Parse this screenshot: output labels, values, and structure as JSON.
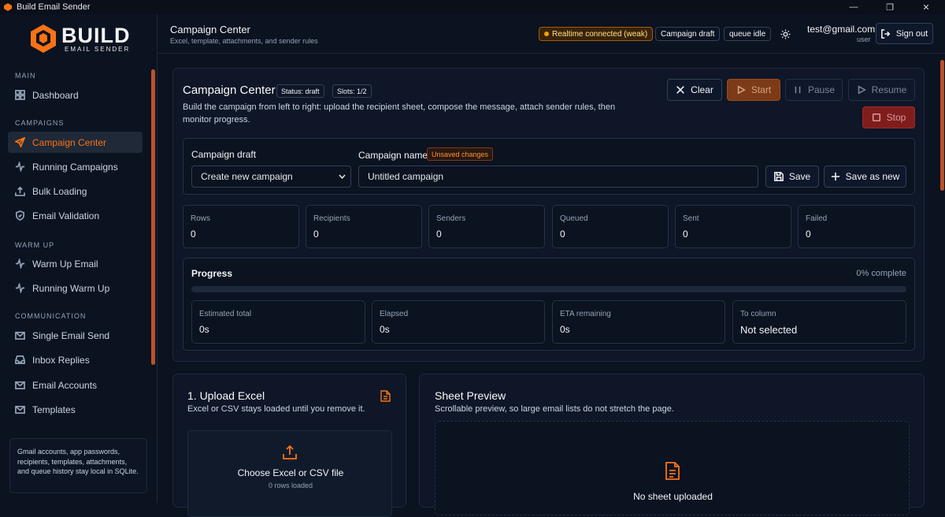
{
  "window": {
    "title": "Build Email Sender"
  },
  "brand": {
    "name": "BUILD",
    "tagline": "EMAIL SENDER",
    "accent": "#f97316"
  },
  "sidebar": {
    "sections": [
      {
        "title": "MAIN",
        "items": [
          {
            "label": "Dashboard",
            "icon": "grid-icon"
          }
        ]
      },
      {
        "title": "CAMPAIGNS",
        "items": [
          {
            "label": "Campaign Center",
            "icon": "send-icon",
            "active": true
          },
          {
            "label": "Running Campaigns",
            "icon": "activity-icon"
          },
          {
            "label": "Bulk Loading",
            "icon": "upload-icon"
          },
          {
            "label": "Email Validation",
            "icon": "shield-check-icon"
          }
        ]
      },
      {
        "title": "WARM UP",
        "items": [
          {
            "label": "Warm Up Email",
            "icon": "activity-icon"
          },
          {
            "label": "Running Warm Up",
            "icon": "activity-icon"
          }
        ]
      },
      {
        "title": "COMMUNICATION",
        "items": [
          {
            "label": "Single Email Send",
            "icon": "mail-icon"
          },
          {
            "label": "Inbox Replies",
            "icon": "inbox-icon"
          },
          {
            "label": "Email Accounts",
            "icon": "at-sign-icon"
          },
          {
            "label": "Templates",
            "icon": "mail-icon"
          }
        ]
      }
    ],
    "note": "Gmail accounts, app passwords, recipients, templates, attachments, and queue history stay local in SQLite."
  },
  "header": {
    "title": "Campaign Center",
    "subtitle": "Excel, template, attachments, and sender rules",
    "connection": "Realtime connected (weak)",
    "draft_badge": "Campaign draft",
    "queue_badge": "queue idle",
    "user_email": "test@gmail.com",
    "user_role": "user",
    "signout": "Sign out"
  },
  "campaign": {
    "title": "Campaign Center",
    "status": "Status: draft",
    "slots": "Slots: 1/2",
    "description": "Build the campaign from left to right: upload the recipient sheet, compose the message, attach sender rules, then monitor progress.",
    "actions": {
      "clear": "Clear",
      "start": "Start",
      "pause": "Pause",
      "resume": "Resume",
      "stop": "Stop"
    },
    "draft_label": "Campaign draft",
    "draft_select": "Create new campaign",
    "name_label": "Campaign name",
    "unsaved": "Unsaved changes",
    "name_value": "Untitled campaign",
    "save": "Save",
    "save_as_new": "Save as new"
  },
  "stats": [
    {
      "label": "Rows",
      "value": "0"
    },
    {
      "label": "Recipients",
      "value": "0"
    },
    {
      "label": "Senders",
      "value": "0"
    },
    {
      "label": "Queued",
      "value": "0"
    },
    {
      "label": "Sent",
      "value": "0"
    },
    {
      "label": "Failed",
      "value": "0"
    }
  ],
  "progress": {
    "title": "Progress",
    "percent_text": "0% complete",
    "fraction": 0,
    "metrics": [
      {
        "label": "Estimated total",
        "value": "0s"
      },
      {
        "label": "Elapsed",
        "value": "0s"
      },
      {
        "label": "ETA remaining",
        "value": "0s"
      },
      {
        "label": "To column",
        "value": "Not selected"
      }
    ]
  },
  "upload": {
    "title": "1. Upload Excel",
    "subtitle": "Excel or CSV stays loaded until you remove it.",
    "choose": "Choose Excel or CSV file",
    "rows_loaded": "0 rows loaded"
  },
  "preview": {
    "title": "Sheet Preview",
    "subtitle": "Scrollable preview, so large email lists do not stretch the page.",
    "empty": "No sheet uploaded"
  }
}
